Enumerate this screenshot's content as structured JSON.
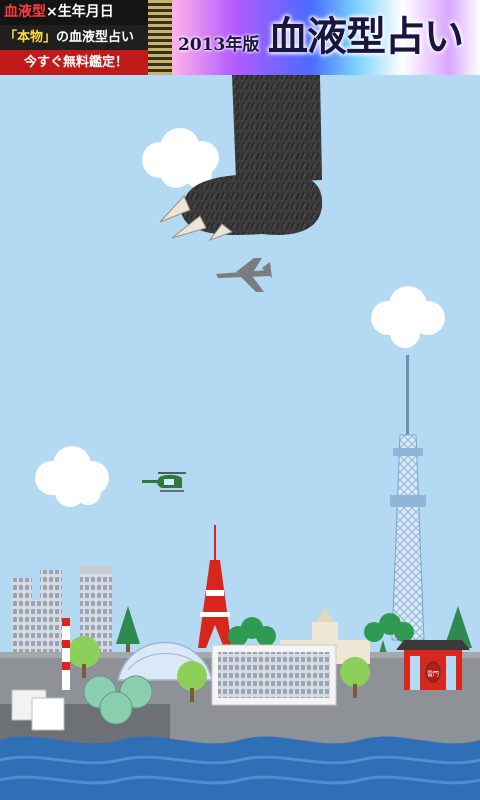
{
  "ad_banner": {
    "line1_a": "血液型",
    "line1_b": "×生年月日",
    "line2_a": "「本物」",
    "line2_b": "の血液型占い",
    "line3": "今すぐ無料鑑定！",
    "year_label": "2013年版",
    "title": "血液型占い"
  },
  "scene": {
    "gate_lantern_text": "雷門",
    "colors": {
      "sky": "#b3d9f3",
      "sea": "#2e6fb6",
      "ground": "#8e9296",
      "monster": "#3a3a3a",
      "tower": "#d9261c"
    }
  }
}
